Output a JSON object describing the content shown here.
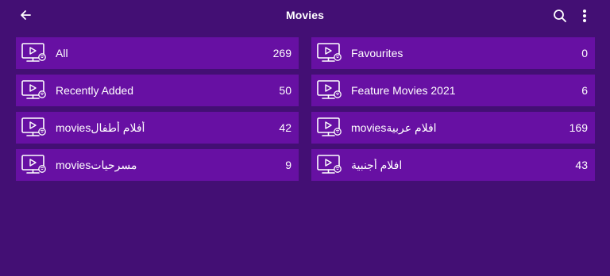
{
  "header": {
    "title": "Movies",
    "back_icon": "arrow-left-icon",
    "search_icon": "search-icon",
    "more_icon": "more-vertical-icon"
  },
  "colors": {
    "background": "#430f74",
    "card": "#6710a3",
    "text": "#ffffff"
  },
  "categories": [
    {
      "label": "All",
      "count": "269",
      "icon": "tv-play-icon"
    },
    {
      "label": "Favourites",
      "count": "0",
      "icon": "tv-play-icon"
    },
    {
      "label": "Recently Added",
      "count": "50",
      "icon": "tv-play-icon"
    },
    {
      "label": "Feature Movies 2021",
      "count": "6",
      "icon": "tv-play-icon"
    },
    {
      "label": "moviesأفلام أطفال",
      "count": "42",
      "icon": "tv-play-icon"
    },
    {
      "label": "moviesافلام عربية",
      "count": "169",
      "icon": "tv-play-icon"
    },
    {
      "label": "moviesمسرحيات",
      "count": "9",
      "icon": "tv-play-icon"
    },
    {
      "label": "افلام أجنبية",
      "count": "43",
      "icon": "tv-play-icon"
    }
  ]
}
